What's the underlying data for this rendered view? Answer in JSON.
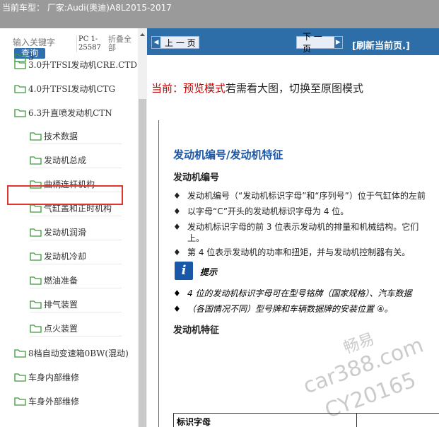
{
  "header": {
    "title": "当前车型： 厂家:Audi(奥迪)A8L2015-2017"
  },
  "search": {
    "placeholder": "输入关键字",
    "button_label": "查询",
    "pc_info": "PC 1-25587",
    "collapse_all": "折叠全部"
  },
  "tree": {
    "items": [
      {
        "label": "3.0升TFSI发动机CRE.CTD",
        "level": 0
      },
      {
        "label": "4.0升TFSI发动机CTG",
        "level": 0
      },
      {
        "label": "6.3升直喷发动机CTN",
        "level": 0,
        "selected": true
      },
      {
        "label": "技术数据",
        "level": 1
      },
      {
        "label": "发动机总成",
        "level": 1
      },
      {
        "label": "曲柄连杆机构",
        "level": 1
      },
      {
        "label": "气缸盖和正时机构",
        "level": 1
      },
      {
        "label": "发动机润滑",
        "level": 1
      },
      {
        "label": "发动机冷却",
        "level": 1
      },
      {
        "label": "燃油准备",
        "level": 1
      },
      {
        "label": "排气装置",
        "level": 1
      },
      {
        "label": "点火装置",
        "level": 1
      },
      {
        "label": "8档自动变速箱0BW(混动)",
        "level": 0
      },
      {
        "label": "车身内部维修",
        "level": 0
      },
      {
        "label": "车身外部维修",
        "level": 0
      }
    ]
  },
  "nav": {
    "prev_label": "上 一 页",
    "next_label": "下 一 页",
    "refresh_label": "[刷新当前页.]"
  },
  "mode": {
    "prefix": "当前：",
    "mode_name": "预览模式",
    "hint": "若需看大图，切换至原图模式"
  },
  "doc": {
    "title": "发动机编号/发动机特征",
    "section1": "发动机编号",
    "bullets": [
      "发动机编号（“发动机标识字母”和“序列号”）位于气缸体的左前",
      "以字母“C”开头的发动机标识字母为 4 位。",
      "发动机标识字母的前 3 位表示发动机的排量和机械结构。它们",
      "上。",
      "第 4 位表示发动机的功率和扭矩，并与发动机控制器有关。"
    ],
    "note_title": "提示",
    "note_lines": [
      "4 位的发动机标识字母可在型号铭牌（国家规格）、汽车数据",
      "（各国情况不同）型号牌和车辆数据牌的安装位置 ④。"
    ],
    "section2": "发动机特征",
    "table_header": "标识字母",
    "watermarks": [
      "畅易",
      "car388.com",
      "CY20165"
    ]
  },
  "colors": {
    "header_bg": "#9a9a9a",
    "nav_bg": "#2d6da8",
    "selected_border": "#e0342e",
    "doc_title": "#1a57a6",
    "mode_red": "#c40000"
  },
  "icons": {
    "folder": "folder-icon",
    "prev_arrow": "arrow-left-icon",
    "next_arrow": "arrow-right-icon",
    "note": "info-icon"
  }
}
